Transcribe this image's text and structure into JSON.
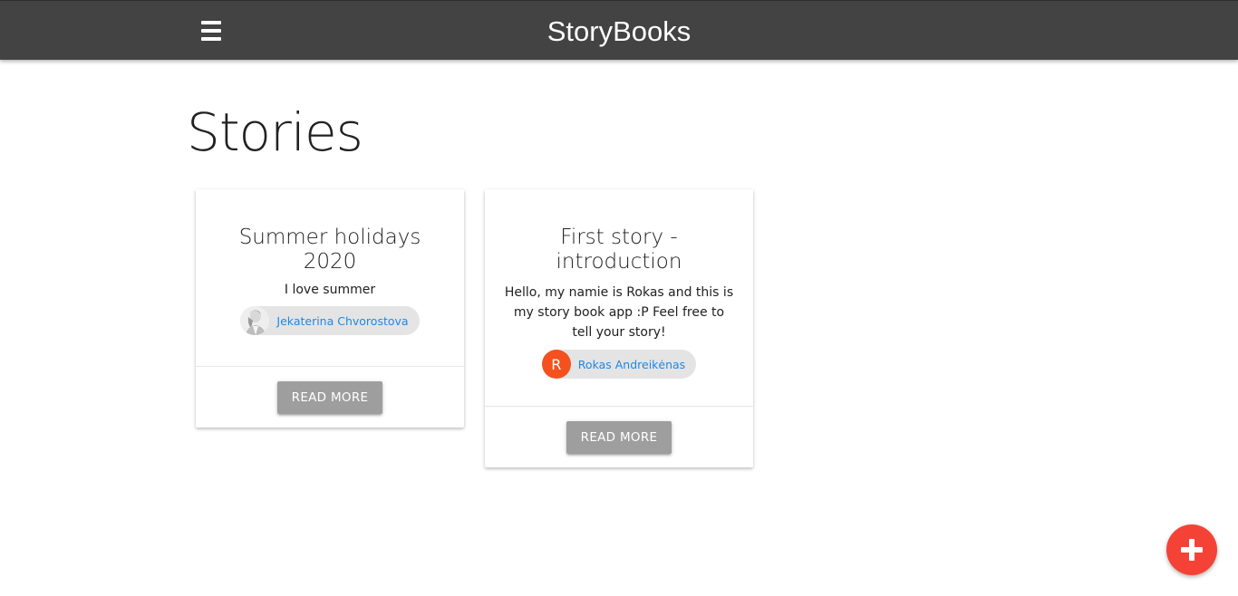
{
  "navbar": {
    "brand": "StoryBooks",
    "menu_icon": "hamburger-menu-icon",
    "background": "#434343"
  },
  "page": {
    "title": "Stories"
  },
  "stories": [
    {
      "title": "Summer holidays 2020",
      "body": "I love summer",
      "author": "Jekaterina Chvorostova",
      "avatar": "user-photo",
      "read_more": "READ MORE"
    },
    {
      "title": "First story - introduction",
      "body": "Hello, my namie is Rokas and this is my story book app :P Feel free to tell your story!",
      "author": "Rokas Andreikėnas",
      "avatar_letter": "R",
      "read_more": "READ MORE"
    }
  ],
  "fab": {
    "icon": "plus-icon",
    "color": "#f44336"
  },
  "colors": {
    "author_link": "#1e88e5",
    "button": "#9e9e9e",
    "avatar_letter_bg": "#f4511e"
  }
}
